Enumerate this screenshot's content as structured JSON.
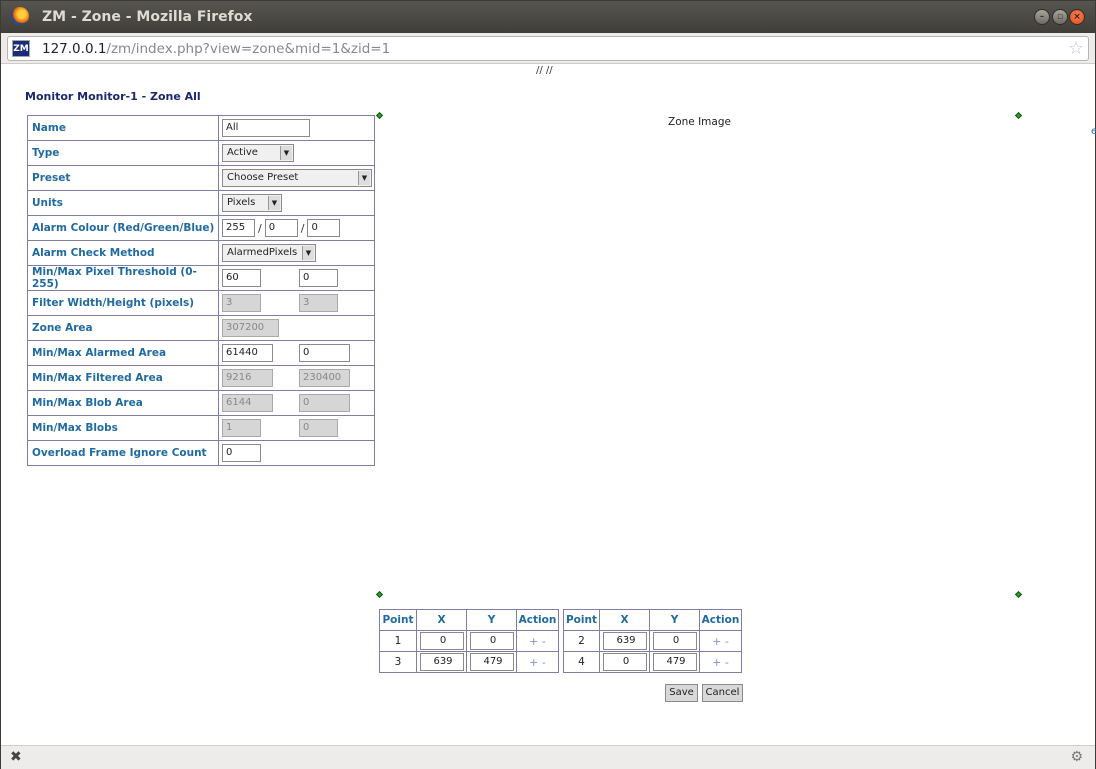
{
  "window": {
    "title": "ZM - Zone - Mozilla Firefox"
  },
  "browser": {
    "url_host": "127.0.0.1",
    "url_path": "/zm/index.php?view=zone&mid=1&zid=1",
    "site_icon": "ZM"
  },
  "page": {
    "top_text": "// //",
    "title": "Monitor Monitor-1 - Zone All",
    "zone_image_caption": "Zone Image",
    "edge_mark": "e"
  },
  "form": {
    "name": {
      "label": "Name",
      "value": "All"
    },
    "type": {
      "label": "Type",
      "value": "Active"
    },
    "preset": {
      "label": "Preset",
      "value": "Choose Preset"
    },
    "units": {
      "label": "Units",
      "value": "Pixels"
    },
    "alarm_colour": {
      "label": "Alarm Colour (Red/Green/Blue)",
      "r": "255",
      "g": "0",
      "b": "0",
      "sep": "/"
    },
    "check_method": {
      "label": "Alarm Check Method",
      "value": "AlarmedPixels"
    },
    "pixel_threshold": {
      "label": "Min/Max Pixel Threshold (0-255)",
      "min": "60",
      "max": "0"
    },
    "filter_size": {
      "label": "Filter Width/Height (pixels)",
      "width": "3",
      "height": "3"
    },
    "zone_area": {
      "label": "Zone Area",
      "value": "307200"
    },
    "alarmed_area": {
      "label": "Min/Max Alarmed Area",
      "min": "61440",
      "max": "0"
    },
    "filtered_area": {
      "label": "Min/Max Filtered Area",
      "min": "9216",
      "max": "230400"
    },
    "blob_area": {
      "label": "Min/Max Blob Area",
      "min": "6144",
      "max": "0"
    },
    "blobs": {
      "label": "Min/Max Blobs",
      "min": "1",
      "max": "0"
    },
    "overload_ignore": {
      "label": "Overload Frame Ignore Count",
      "value": "0"
    }
  },
  "points": {
    "headers": [
      "Point",
      "X",
      "Y",
      "Action"
    ],
    "action_add": "+",
    "action_remove": "-",
    "rows": [
      {
        "point": "1",
        "x": "0",
        "y": "0"
      },
      {
        "point": "2",
        "x": "639",
        "y": "0"
      },
      {
        "point": "3",
        "x": "639",
        "y": "479"
      },
      {
        "point": "4",
        "x": "0",
        "y": "479"
      }
    ]
  },
  "buttons": {
    "save": "Save",
    "cancel": "Cancel"
  },
  "icons": {
    "firefox": "firefox-logo-icon",
    "minimize": "minimize-icon",
    "maximize": "maximize-icon",
    "close": "close-icon",
    "bookmark": "star-icon",
    "status_close": "close-x-icon",
    "status_addon": "addon-gear-icon"
  },
  "colors": {
    "label": "#1f6aa0",
    "title": "#1a2870",
    "border": "#7e7ea8",
    "corner": "#2aa02a"
  }
}
